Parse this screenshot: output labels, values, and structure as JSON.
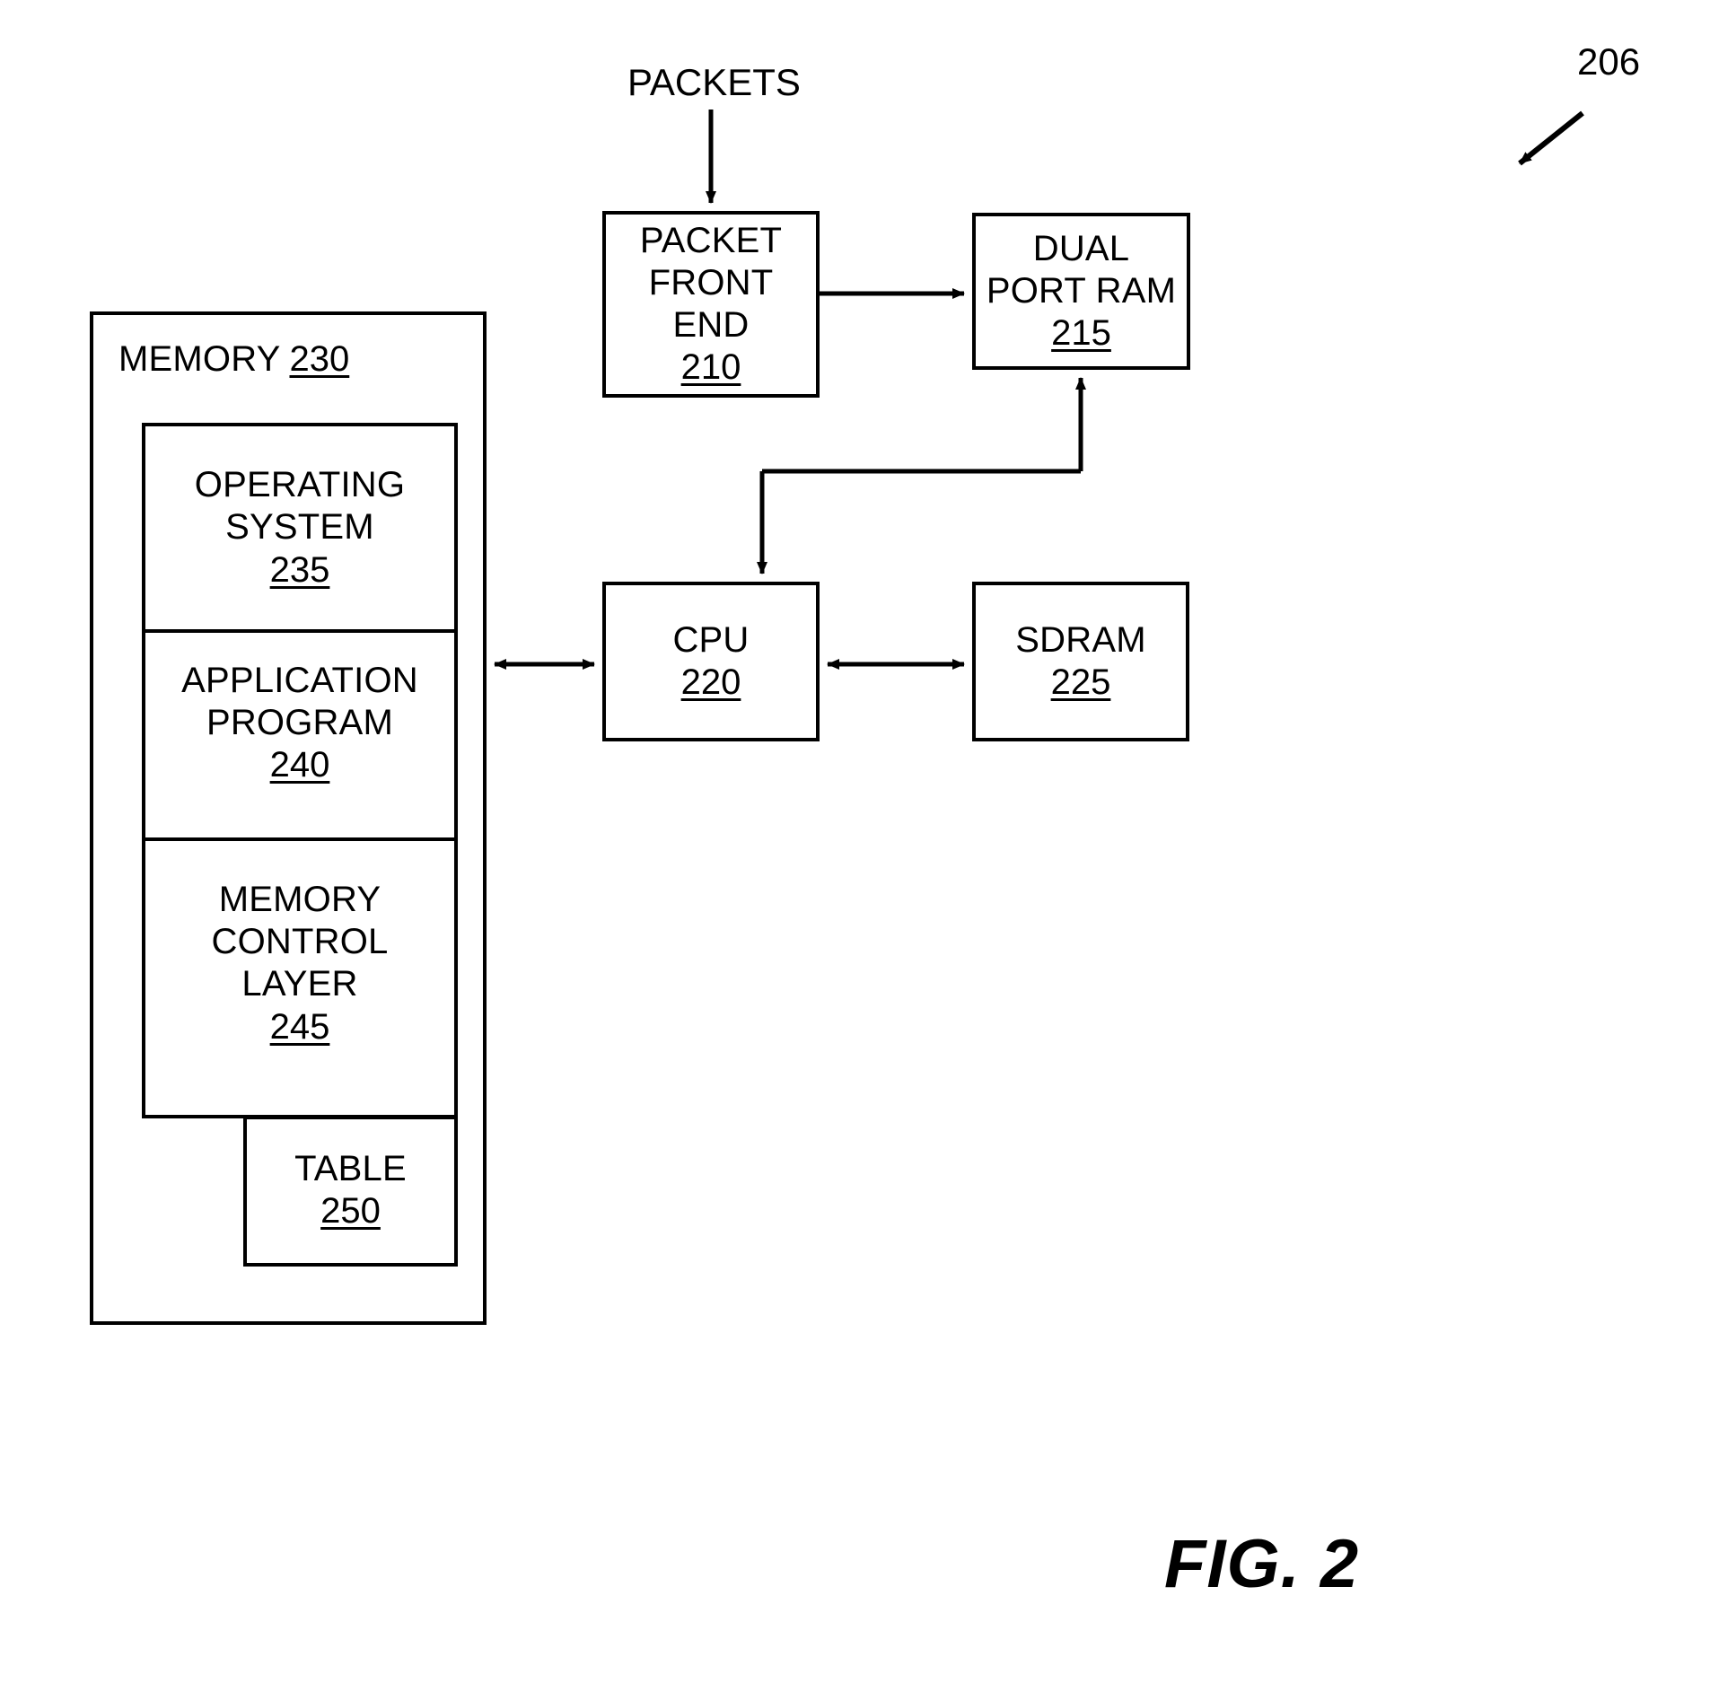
{
  "figure": {
    "caption": "FIG. 2",
    "system_ref": "206",
    "input_label": "PACKETS"
  },
  "blocks": {
    "memory": {
      "label": "MEMORY",
      "ref": "230"
    },
    "operating_system": {
      "label": "OPERATING\nSYSTEM",
      "ref": "235"
    },
    "application_program": {
      "label": "APPLICATION\nPROGRAM",
      "ref": "240"
    },
    "memory_control_layer": {
      "label": "MEMORY\nCONTROL\nLAYER",
      "ref": "245"
    },
    "table": {
      "label": "TABLE",
      "ref": "250"
    },
    "packet_front_end": {
      "label": "PACKET\nFRONT\nEND",
      "ref": "210"
    },
    "dual_port_ram": {
      "label": "DUAL\nPORT RAM",
      "ref": "215"
    },
    "cpu": {
      "label": "CPU",
      "ref": "220"
    },
    "sdram": {
      "label": "SDRAM",
      "ref": "225"
    }
  },
  "connectors": [
    {
      "name": "packets-to-packet-front-end",
      "from": "PACKETS",
      "to": "PACKET FRONT END",
      "arrow": "single"
    },
    {
      "name": "packet-front-end-to-dual-port-ram",
      "from": "PACKET FRONT END",
      "to": "DUAL PORT RAM",
      "arrow": "single"
    },
    {
      "name": "cpu-to-dual-port-ram",
      "from": "CPU",
      "to": "DUAL PORT RAM",
      "arrow": "double-elbow"
    },
    {
      "name": "memory-to-cpu",
      "from": "MEMORY",
      "to": "CPU",
      "arrow": "double"
    },
    {
      "name": "cpu-to-sdram",
      "from": "CPU",
      "to": "SDRAM",
      "arrow": "double"
    },
    {
      "name": "system-ref-pointer",
      "from": "206",
      "to": "diagram",
      "arrow": "single"
    }
  ],
  "colors": {
    "stroke": "#000000",
    "background": "#ffffff"
  }
}
